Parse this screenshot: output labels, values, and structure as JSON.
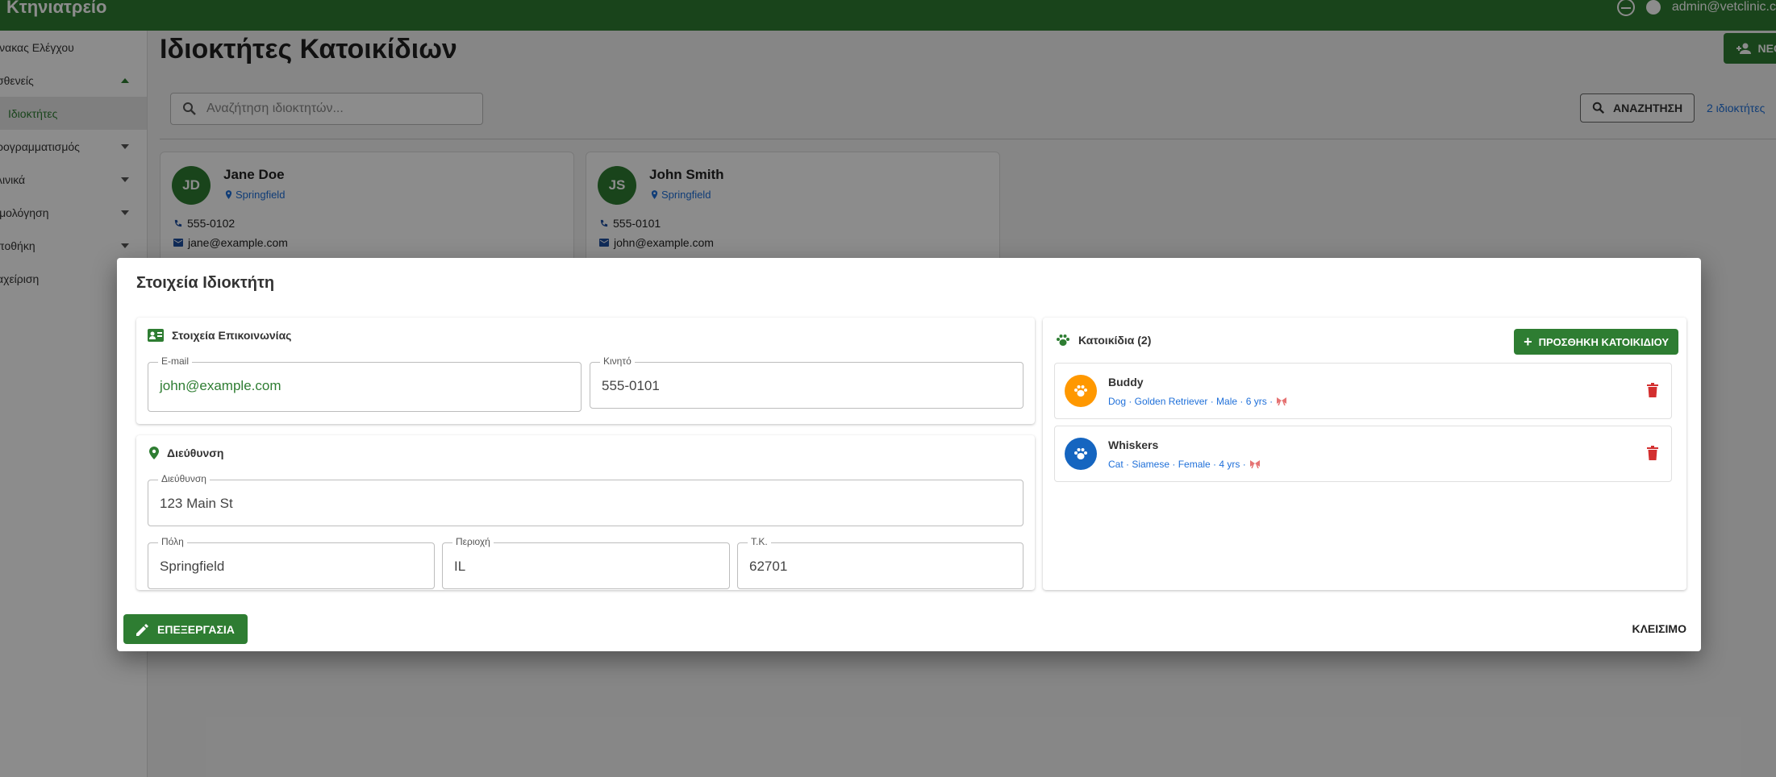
{
  "appbar": {
    "brand": "Κτηνιατρείο",
    "user": "admin@vetclinic.c"
  },
  "sidebar": {
    "items": [
      {
        "label": "ίνακας Ελέγχου"
      },
      {
        "label": "σθενείς"
      },
      {
        "label": "Ιδιοκτήτες"
      },
      {
        "label": "ρογραμματισμός"
      },
      {
        "label": "λινικά"
      },
      {
        "label": "ιμολόγηση"
      },
      {
        "label": "ποθήκη"
      },
      {
        "label": "αχείριση"
      }
    ]
  },
  "main": {
    "title": "Ιδιοκτήτες Κατοικίδιων",
    "new_owner": "ΝΕΟΣ Ι",
    "search_placeholder": "Αναζήτηση ιδιοκτητών...",
    "search_button": "ΑΝΑΖΗΤΗΣΗ",
    "count": "2 ιδιοκτήτες"
  },
  "owners": [
    {
      "initials": "JD",
      "name": "Jane Doe",
      "city": "Springfield",
      "phone": "555-0102",
      "email": "jane@example.com"
    },
    {
      "initials": "JS",
      "name": "John Smith",
      "city": "Springfield",
      "phone": "555-0101",
      "email": "john@example.com"
    }
  ],
  "dialog": {
    "title": "Στοιχεία Ιδιοκτήτη",
    "contact": {
      "heading": "Στοιχεία Επικοινωνίας",
      "email_label": "E-mail",
      "email_value": "john@example.com",
      "mobile_label": "Κινητό",
      "mobile_value": "555-0101"
    },
    "address": {
      "heading": "Διεύθυνση",
      "street_label": "Διεύθυνση",
      "street_value": "123 Main St",
      "city_label": "Πόλη",
      "city_value": "Springfield",
      "region_label": "Περιοχή",
      "region_value": "IL",
      "zip_label": "Τ.Κ.",
      "zip_value": "62701"
    },
    "pets": {
      "heading": "Κατοικίδια (2)",
      "add_button": "ΠΡΟΣΘΗΚΗ ΚΑΤΟΙΚΙΔΙΟΥ",
      "items": [
        {
          "name": "Buddy",
          "desc": "Dog · Golden Retriever · Male · 6 yrs ·",
          "color": "#ff9800"
        },
        {
          "name": "Whiskers",
          "desc": "Cat · Siamese · Female · 4 yrs ·",
          "color": "#1565c0"
        }
      ]
    },
    "edit_button": "ΕΠΕΞΕΡΓΑΣΙΑ",
    "close_button": "ΚΛΕΙΣΙΜΟ"
  },
  "colors": {
    "primary": "#2e7d32",
    "link": "#1e6fd9",
    "danger": "#d32f2f"
  }
}
